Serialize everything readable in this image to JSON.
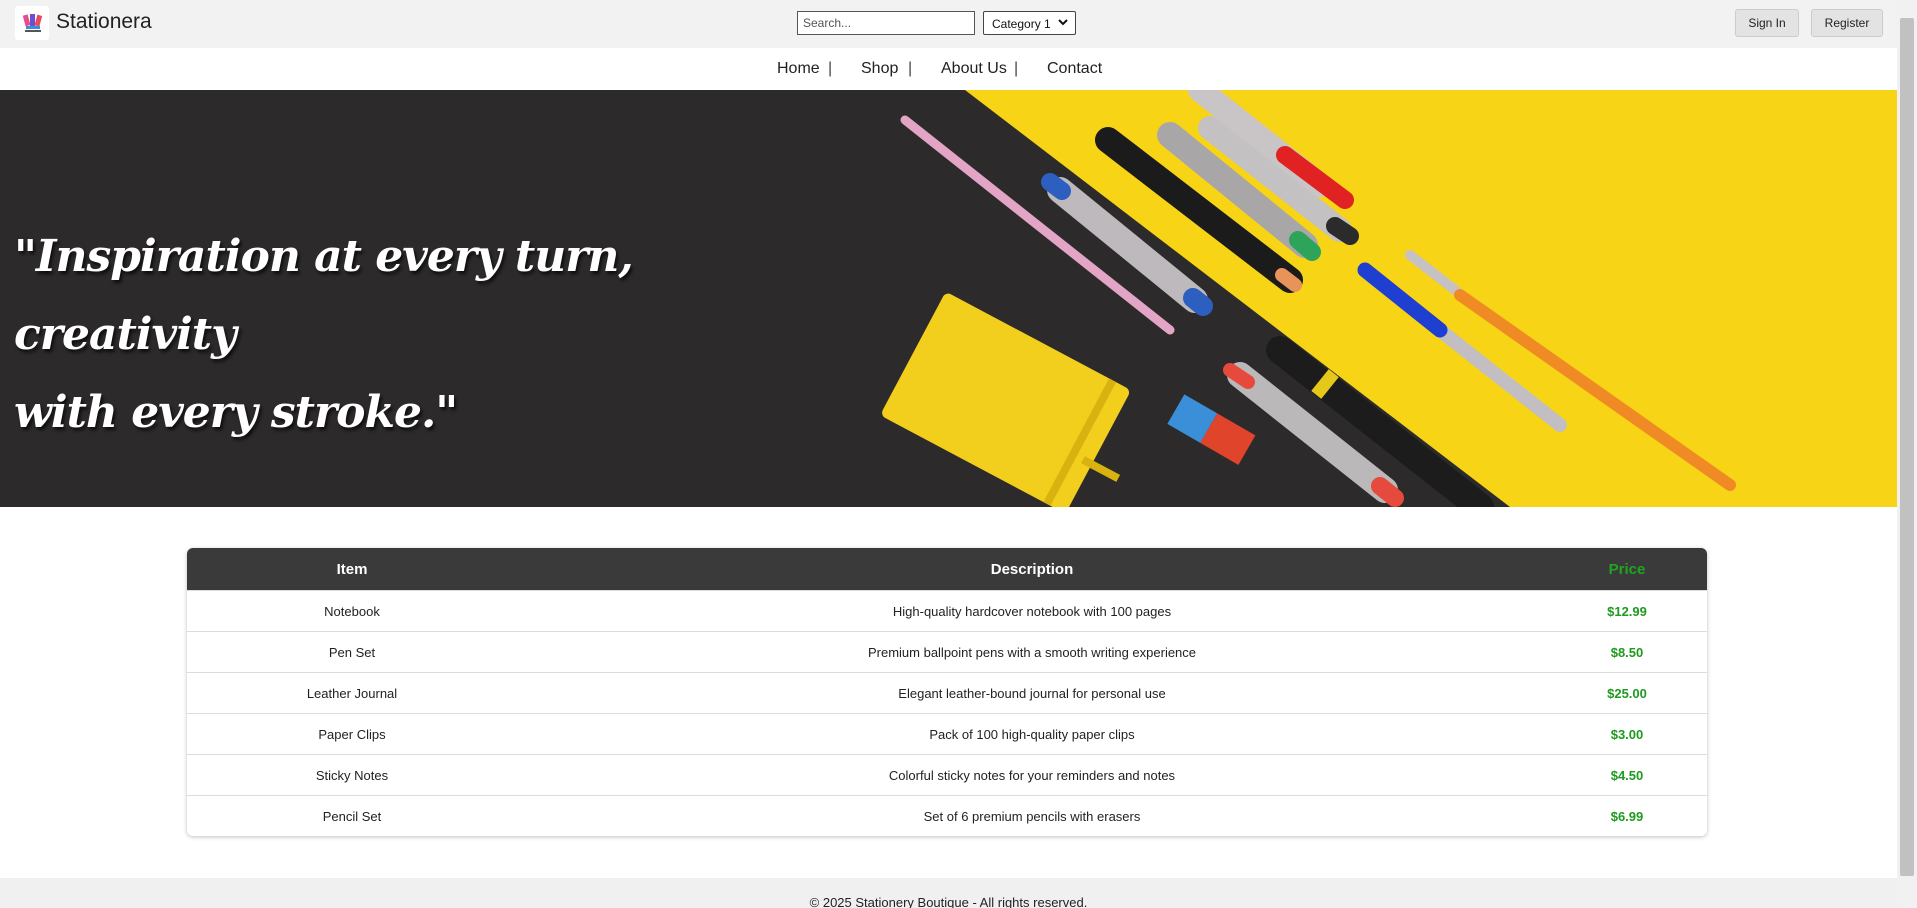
{
  "header": {
    "brand": "Stationera",
    "search_placeholder": "Search...",
    "category_selected": "Category 1",
    "signin_label": "Sign In",
    "register_label": "Register"
  },
  "nav": {
    "items": [
      "Home",
      "Shop",
      "About Us",
      "Contact"
    ],
    "separator": "|"
  },
  "hero": {
    "quote_line1": "\"Inspiration at every turn, creativity",
    "quote_line2": "with every stroke.\""
  },
  "table": {
    "headers": {
      "item": "Item",
      "description": "Description",
      "price": "Price"
    },
    "rows": [
      {
        "item": "Notebook",
        "description": "High-quality hardcover notebook with 100 pages",
        "price": "$12.99"
      },
      {
        "item": "Pen Set",
        "description": "Premium ballpoint pens with a smooth writing experience",
        "price": "$8.50"
      },
      {
        "item": "Leather Journal",
        "description": "Elegant leather-bound journal for personal use",
        "price": "$25.00"
      },
      {
        "item": "Paper Clips",
        "description": "Pack of 100 high-quality paper clips",
        "price": "$3.00"
      },
      {
        "item": "Sticky Notes",
        "description": "Colorful sticky notes for your reminders and notes",
        "price": "$4.50"
      },
      {
        "item": "Pencil Set",
        "description": "Set of 6 premium pencils with erasers",
        "price": "$6.99"
      }
    ]
  },
  "footer": {
    "text": "© 2025 Stationery Boutique - All rights reserved."
  },
  "colors": {
    "accent_green": "#1e9a1e",
    "hero_yellow": "#f7d416",
    "hero_dark": "#2d2a2b",
    "table_header": "#3a3a3a"
  }
}
